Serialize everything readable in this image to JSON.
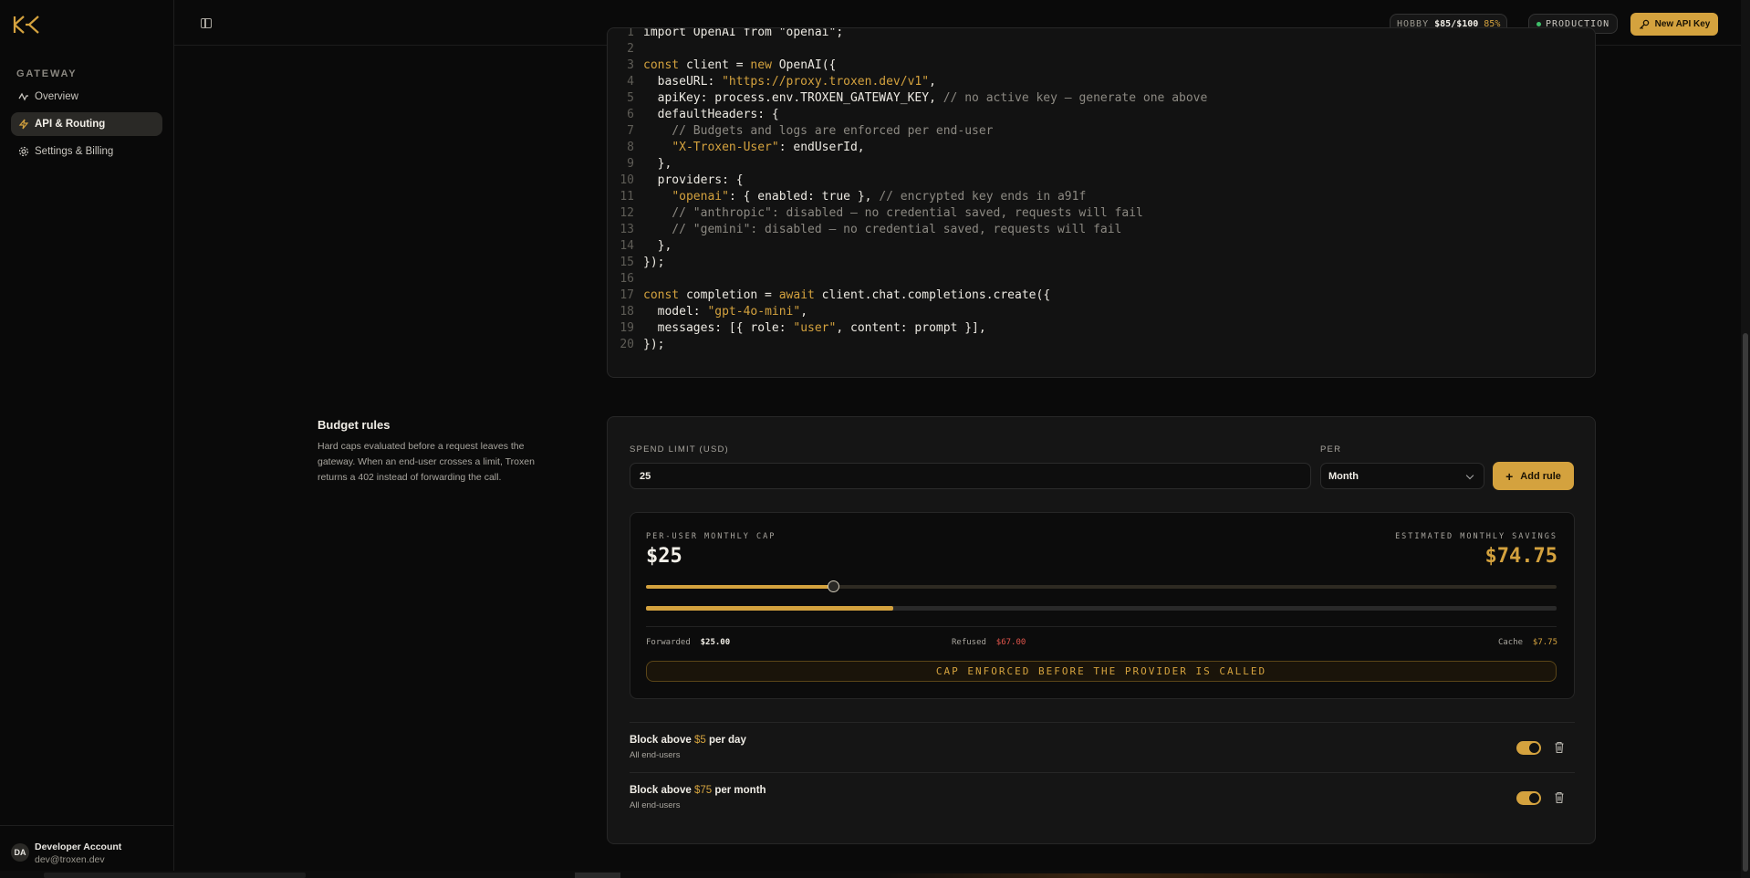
{
  "sidebar": {
    "section": "GATEWAY",
    "items": [
      {
        "label": "Overview",
        "icon": "activity-icon"
      },
      {
        "label": "API & Routing",
        "icon": "zap-icon"
      },
      {
        "label": "Settings & Billing",
        "icon": "gear-icon"
      }
    ],
    "account": {
      "initials": "DA",
      "name": "Developer Account",
      "email": "dev@troxen.dev"
    }
  },
  "topbar": {
    "plan_label": "HOBBY",
    "plan_usage": "$85/$100",
    "plan_percent": "85%",
    "environment": "PRODUCTION",
    "new_key_label": "New API Key"
  },
  "code": {
    "lines": [
      [
        {
          "t": "import OpenAI from \"openai\";",
          "c": ""
        }
      ],
      [],
      [
        {
          "t": "const",
          "c": "kw"
        },
        {
          "t": " client = ",
          "c": ""
        },
        {
          "t": "new",
          "c": "kw"
        },
        {
          "t": " OpenAI({",
          "c": ""
        }
      ],
      [
        {
          "t": "  baseURL: ",
          "c": ""
        },
        {
          "t": "\"https://proxy.troxen.dev/v1\"",
          "c": "str"
        },
        {
          "t": ",",
          "c": ""
        }
      ],
      [
        {
          "t": "  apiKey: process.env.TROXEN_GATEWAY_KEY, ",
          "c": ""
        },
        {
          "t": "// no active key — generate one above",
          "c": "cm"
        }
      ],
      [
        {
          "t": "  defaultHeaders: {",
          "c": ""
        }
      ],
      [
        {
          "t": "    // Budgets and logs are enforced per end-user",
          "c": "cm"
        }
      ],
      [
        {
          "t": "    ",
          "c": ""
        },
        {
          "t": "\"X-Troxen-User\"",
          "c": "str"
        },
        {
          "t": ": endUserId,",
          "c": ""
        }
      ],
      [
        {
          "t": "  },",
          "c": ""
        }
      ],
      [
        {
          "t": "  providers: {",
          "c": ""
        }
      ],
      [
        {
          "t": "    ",
          "c": ""
        },
        {
          "t": "\"openai\"",
          "c": "str"
        },
        {
          "t": ": { enabled: true }, ",
          "c": ""
        },
        {
          "t": "// encrypted key ends in a91f",
          "c": "cm"
        }
      ],
      [
        {
          "t": "    // \"anthropic\": disabled — no credential saved, requests will fail",
          "c": "cm"
        }
      ],
      [
        {
          "t": "    // \"gemini\": disabled — no credential saved, requests will fail",
          "c": "cm"
        }
      ],
      [
        {
          "t": "  },",
          "c": ""
        }
      ],
      [
        {
          "t": "});",
          "c": ""
        }
      ],
      [],
      [
        {
          "t": "const",
          "c": "kw"
        },
        {
          "t": " completion = ",
          "c": ""
        },
        {
          "t": "await",
          "c": "kw"
        },
        {
          "t": " client.chat.completions.create({",
          "c": ""
        }
      ],
      [
        {
          "t": "  model: ",
          "c": ""
        },
        {
          "t": "\"gpt-4o-mini\"",
          "c": "str"
        },
        {
          "t": ",",
          "c": ""
        }
      ],
      [
        {
          "t": "  messages: [{ role: ",
          "c": ""
        },
        {
          "t": "\"user\"",
          "c": "str"
        },
        {
          "t": ", content: prompt }],",
          "c": ""
        }
      ],
      [
        {
          "t": "});",
          "c": ""
        }
      ]
    ]
  },
  "budget": {
    "title": "Budget rules",
    "description": "Hard caps evaluated before a request leaves the gateway. When an end-user crosses a limit, Troxen returns a 402 instead of forwarding the call.",
    "spend_label": "SPEND LIMIT (USD)",
    "spend_value": "25",
    "per_label": "PER",
    "per_value": "Month",
    "add_label": "Add rule",
    "cap_label": "PER-USER MONTHLY CAP",
    "cap_value": "$25",
    "savings_label": "ESTIMATED MONTHLY SAVINGS",
    "savings_value": "$74.75",
    "slider_fraction": 0.205,
    "bar_fraction": 0.272,
    "forwarded_label": "Forwarded",
    "forwarded_value": "$25.00",
    "refused_label": "Refused",
    "refused_value": "$67.00",
    "cache_label": "Cache",
    "cache_value": "$7.75",
    "enforced_text": "CAP ENFORCED BEFORE THE PROVIDER IS CALLED",
    "rules": [
      {
        "prefix": "Block above ",
        "amount": "$5",
        "suffix": " per day",
        "scope": "All end-users"
      },
      {
        "prefix": "Block above ",
        "amount": "$75",
        "suffix": " per month",
        "scope": "All end-users"
      }
    ]
  },
  "colors": {
    "accent": "#d4a23e",
    "danger": "#e0554b",
    "ok": "#3fbf6a"
  }
}
